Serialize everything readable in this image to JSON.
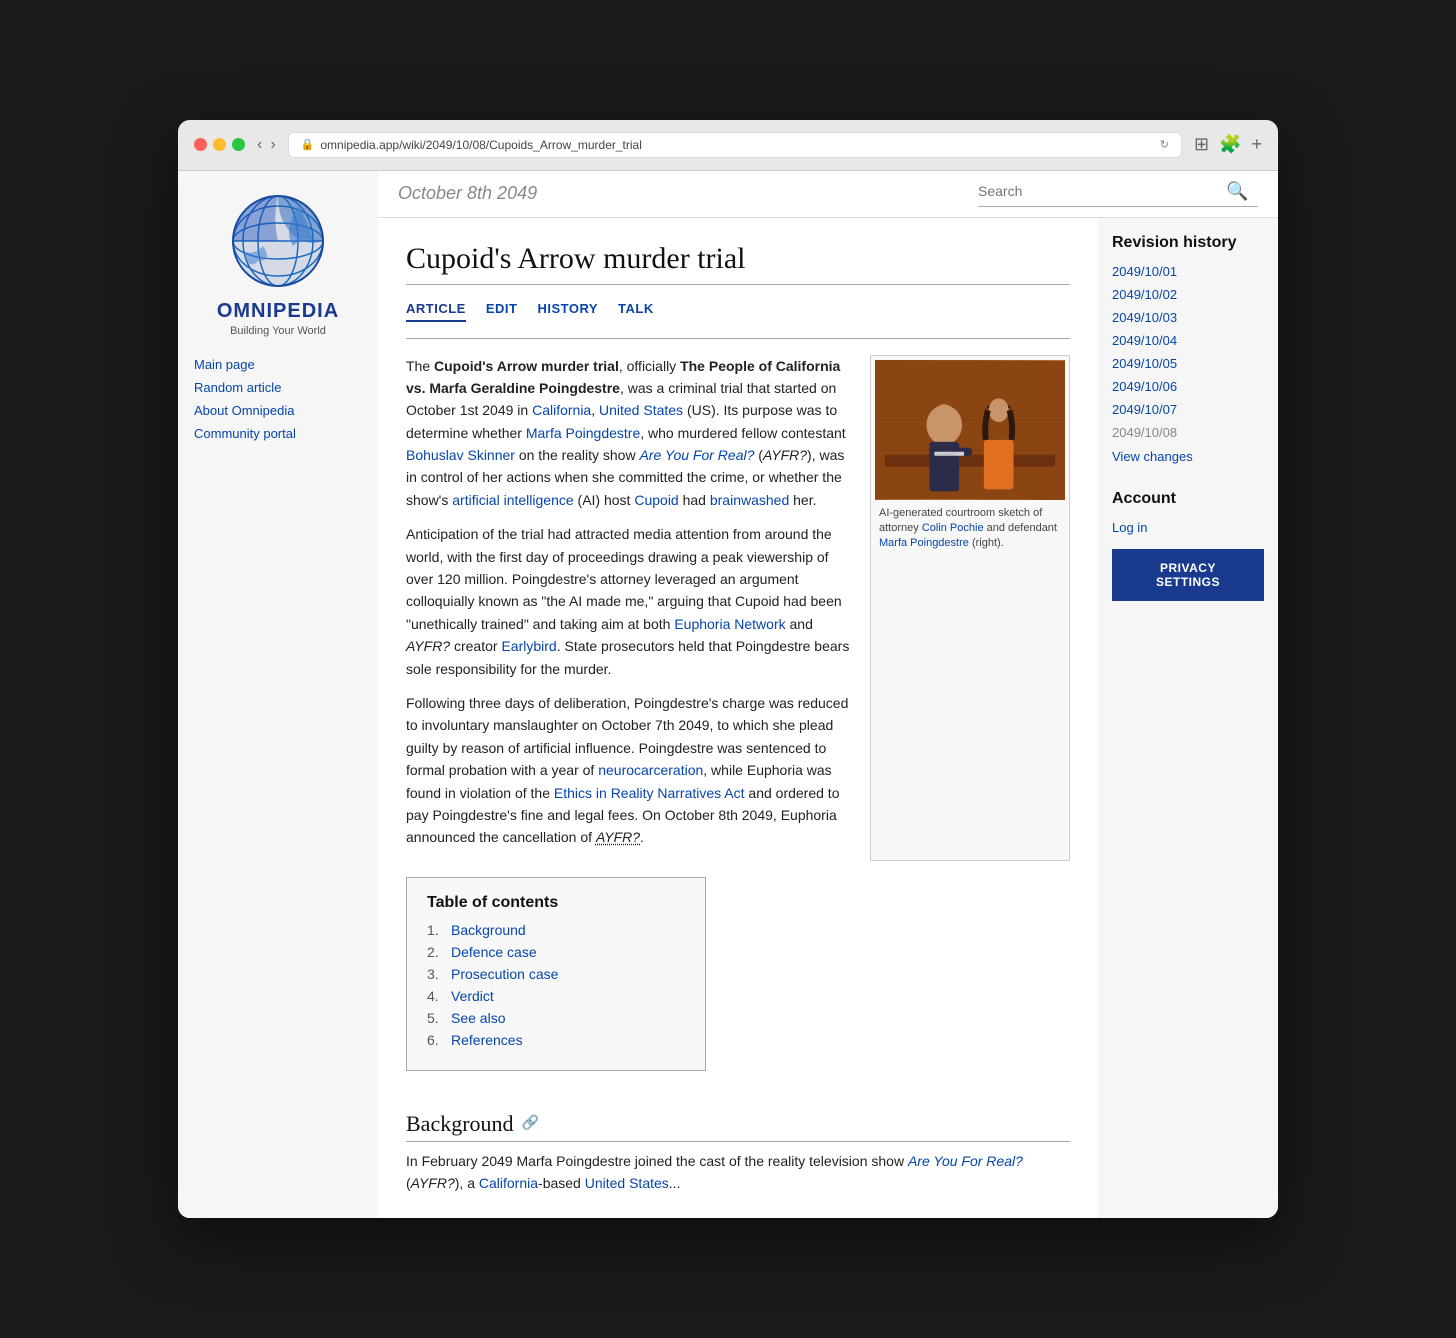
{
  "browser": {
    "url": "omnipedia.app/wiki/2049/10/08/Cupoids_Arrow_murder_trial",
    "lock_icon": "🔒",
    "refresh_icon": "↻"
  },
  "header": {
    "date": "October 8th 2049",
    "search_placeholder": "Search"
  },
  "sidebar": {
    "tagline": "Building Your World",
    "nav_items": [
      {
        "label": "Main page",
        "id": "main-page"
      },
      {
        "label": "Random article",
        "id": "random-article"
      },
      {
        "label": "About Omnipedia",
        "id": "about"
      },
      {
        "label": "Community portal",
        "id": "community"
      }
    ]
  },
  "article": {
    "title": "Cupoid's Arrow murder trial",
    "tabs": [
      {
        "label": "ARTICLE",
        "active": true
      },
      {
        "label": "EDIT",
        "active": false
      },
      {
        "label": "HISTORY",
        "active": false
      },
      {
        "label": "TALK",
        "active": false
      }
    ],
    "intro_paragraphs": [
      "The Cupoid's Arrow murder trial, officially The People of California vs. Marfa Geraldine Poingdestre, was a criminal trial that started on October 1st 2049 in California, United States (US). Its purpose was to determine whether Marfa Poingdestre, who murdered fellow contestant Bohuslav Skinner on the reality show Are You For Real? (AYFR?), was in control of her actions when she committed the crime, or whether the show's artificial intelligence (AI) host Cupoid had brainwashed her.",
      "Anticipation of the trial had attracted media attention from around the world, with the first day of proceedings drawing a peak viewership of over 120 million. Poingdestre's attorney leveraged an argument colloquially known as \"the AI made me,\" arguing that Cupoid had been \"unethically trained\" and taking aim at both Euphoria Network and AYFR? creator Earlybird. State prosecutors held that Poingdestre bears sole responsibility for the murder.",
      "Following three days of deliberation, Poingdestre's charge was reduced to involuntary manslaughter on October 7th 2049, to which she plead guilty by reason of artificial influence. Poingdestre was sentenced to formal probation with a year of neurocarceration, while Euphoria was found in violation of the Ethics in Reality Narratives Act and ordered to pay Poingdestre's fine and legal fees. On October 8th 2049, Euphoria announced the cancellation of AYFR?."
    ],
    "image_caption": "AI-generated courtroom sketch of attorney Colin Pochie and defendant Marfa Poingdestre (right).",
    "toc": {
      "title": "Table of contents",
      "items": [
        {
          "num": "1",
          "label": "Background",
          "href": "#background"
        },
        {
          "num": "2",
          "label": "Defence case",
          "href": "#defence"
        },
        {
          "num": "3",
          "label": "Prosecution case",
          "href": "#prosecution"
        },
        {
          "num": "4",
          "label": "Verdict",
          "href": "#verdict"
        },
        {
          "num": "5",
          "label": "See also",
          "href": "#see-also"
        },
        {
          "num": "6",
          "label": "References",
          "href": "#references"
        }
      ]
    },
    "background_heading": "Background",
    "background_text_preview": "In February 2049 Marfa Poingdestre..."
  },
  "revision_history": {
    "title": "Revision history",
    "links": [
      {
        "label": "2049/10/01",
        "href": "#"
      },
      {
        "label": "2049/10/02",
        "href": "#"
      },
      {
        "label": "2049/10/03",
        "href": "#"
      },
      {
        "label": "2049/10/04",
        "href": "#"
      },
      {
        "label": "2049/10/05",
        "href": "#"
      },
      {
        "label": "2049/10/06",
        "href": "#"
      },
      {
        "label": "2049/10/07",
        "href": "#"
      },
      {
        "label": "2049/10/08",
        "href": "#",
        "current": true
      }
    ],
    "view_changes": "View changes"
  },
  "account": {
    "title": "Account",
    "login_label": "Log in",
    "privacy_button": "PRIVACY\nSETTINGS"
  }
}
